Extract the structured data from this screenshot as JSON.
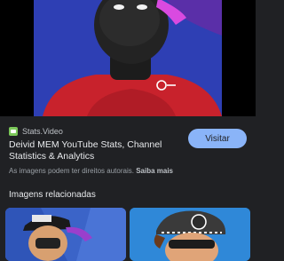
{
  "result": {
    "source": "Stats.Video",
    "title": "Deivid MEM YouTube Stats, Channel Statistics & Analytics",
    "visit_label": "Visitar",
    "copyright_notice": "As imagens podem ter direitos autorais.",
    "learn_more_label": "Saiba mais"
  },
  "related": {
    "heading": "Imagens relacionadas"
  },
  "colors": {
    "page_background": "#202124",
    "accent": "#8ab4f8",
    "favicon": "#7cc85a"
  }
}
